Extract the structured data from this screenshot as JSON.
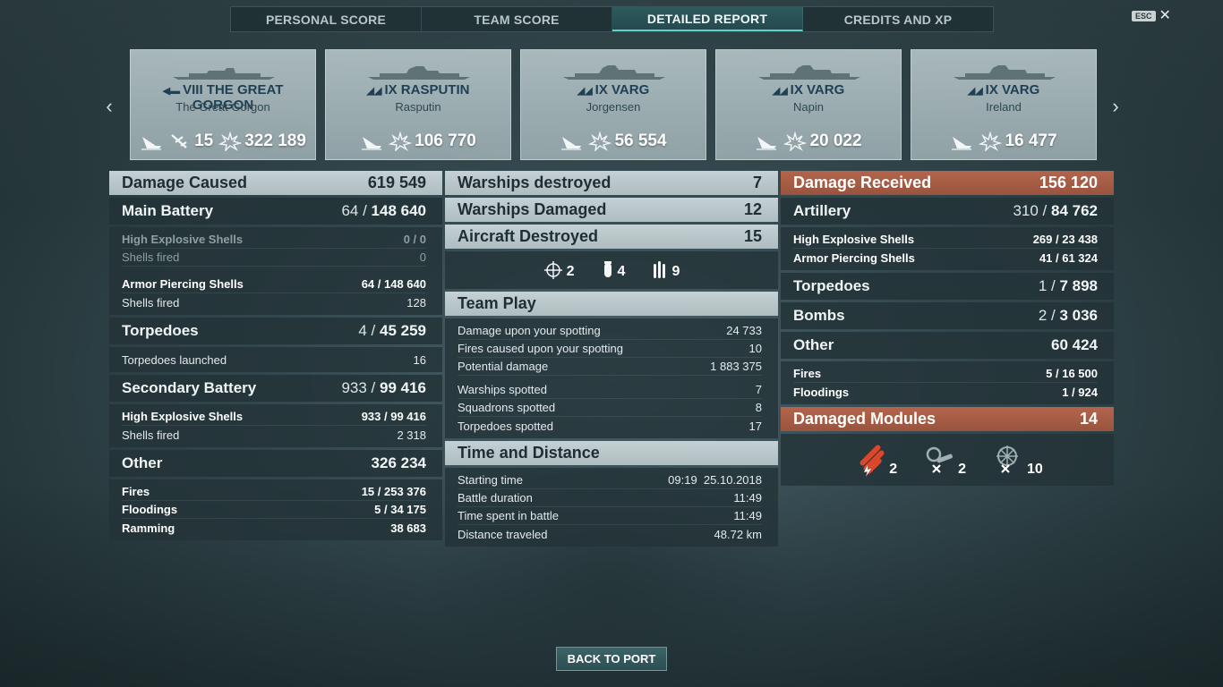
{
  "tabs": [
    "PERSONAL SCORE",
    "TEAM SCORE",
    "DETAILED REPORT",
    "CREDITS AND XP"
  ],
  "active_tab": "DETAILED REPORT",
  "esc": {
    "key": "ESC",
    "close": "✕"
  },
  "nav": {
    "prev": "‹",
    "next": "›"
  },
  "cards": [
    {
      "tier_class": "VIII",
      "ship": "THE GREAT GORGON",
      "player": "The Great Gorgon",
      "planes": "15",
      "damage": "322 189"
    },
    {
      "tier_class": "IX",
      "ship": "RASPUTIN",
      "player": "Rasputin",
      "damage": "106 770"
    },
    {
      "tier_class": "IX",
      "ship": "VARG",
      "player": "Jorgensen",
      "damage": "56 554"
    },
    {
      "tier_class": "IX",
      "ship": "VARG",
      "player": "Napin",
      "damage": "20 022"
    },
    {
      "tier_class": "IX",
      "ship": "VARG",
      "player": "Ireland",
      "damage": "16 477"
    }
  ],
  "left": {
    "damage_caused": {
      "label": "Damage Caused",
      "value": "619 549"
    },
    "main_battery": {
      "label": "Main Battery",
      "hits": "64",
      "sep": " / ",
      "dmg": "148 640"
    },
    "he": {
      "label": "High Explosive Shells",
      "value": "0 / 0"
    },
    "he_fired": {
      "label": "Shells fired",
      "value": "0"
    },
    "ap": {
      "label": "Armor Piercing Shells",
      "hits": "64 / ",
      "dmg": "148 640"
    },
    "ap_fired": {
      "label": "Shells fired",
      "value": "128"
    },
    "torpedoes": {
      "label": "Torpedoes",
      "hits": "4",
      "sep": " / ",
      "dmg": "45 259"
    },
    "torp_launched": {
      "label": "Torpedoes launched",
      "value": "16"
    },
    "secondary": {
      "label": "Secondary Battery",
      "hits": "933",
      "sep": " / ",
      "dmg": "99 416"
    },
    "sec_he": {
      "label": "High Explosive Shells",
      "hits": "933 / ",
      "dmg": "99 416"
    },
    "sec_fired": {
      "label": "Shells fired",
      "value": "2 318"
    },
    "other": {
      "label": "Other",
      "value": "326 234"
    },
    "fires": {
      "label": "Fires",
      "hits": "15 / ",
      "dmg": "253 376"
    },
    "floodings": {
      "label": "Floodings",
      "hits": "5 / ",
      "dmg": "34 175"
    },
    "ramming": {
      "label": "Ramming",
      "dmg": "38 683"
    }
  },
  "mid": {
    "warships_destroyed": {
      "label": "Warships destroyed",
      "value": "7"
    },
    "warships_damaged": {
      "label": "Warships Damaged",
      "value": "12"
    },
    "aircraft_destroyed": {
      "label": "Aircraft Destroyed",
      "value": "15"
    },
    "aircraft_icons": {
      "fighters": "2",
      "bombers": "4",
      "torpedo_bombers": "9"
    },
    "team_play": {
      "label": "Team Play"
    },
    "team_rows": [
      {
        "label": "Damage upon your spotting",
        "value": "24 733"
      },
      {
        "label": "Fires caused upon your spotting",
        "value": "10"
      },
      {
        "label": "Potential damage",
        "value": "1 883 375"
      },
      {
        "label": "Warships spotted",
        "value": "7"
      },
      {
        "label": "Squadrons spotted",
        "value": "8"
      },
      {
        "label": "Torpedoes spotted",
        "value": "17"
      }
    ],
    "time_distance": {
      "label": "Time and Distance"
    },
    "time_rows": [
      {
        "label": "Starting time",
        "value": "09:19  25.10.2018"
      },
      {
        "label": "Battle duration",
        "value": "11:49"
      },
      {
        "label": "Time spent in battle",
        "value": "11:49"
      },
      {
        "label": "Distance traveled",
        "value": "48.72 km"
      }
    ]
  },
  "right": {
    "damage_received": {
      "label": "Damage Received",
      "value": "156 120"
    },
    "artillery": {
      "label": "Artillery",
      "hits": "310",
      "sep": " / ",
      "dmg": "84 762"
    },
    "he": {
      "label": "High Explosive Shells",
      "hits": "269 / ",
      "dmg": "23 438"
    },
    "ap": {
      "label": "Armor Piercing Shells",
      "hits": "41 / ",
      "dmg": "61 324"
    },
    "torpedoes": {
      "label": "Torpedoes",
      "hits": "1",
      "sep": " / ",
      "dmg": "7 898"
    },
    "bombs": {
      "label": "Bombs",
      "hits": "2",
      "sep": " / ",
      "dmg": "3 036"
    },
    "other": {
      "label": "Other",
      "value": "60 424"
    },
    "fires": {
      "label": "Fires",
      "hits": "5 / ",
      "dmg": "16 500"
    },
    "floodings": {
      "label": "Floodings",
      "hits": "1 / ",
      "dmg": "924"
    },
    "damaged_modules": {
      "label": "Damaged Modules",
      "value": "14"
    },
    "modules": {
      "torpedo_tubes": "2",
      "guns": "2",
      "aa": "10"
    }
  },
  "back_button": "BACK TO PORT"
}
